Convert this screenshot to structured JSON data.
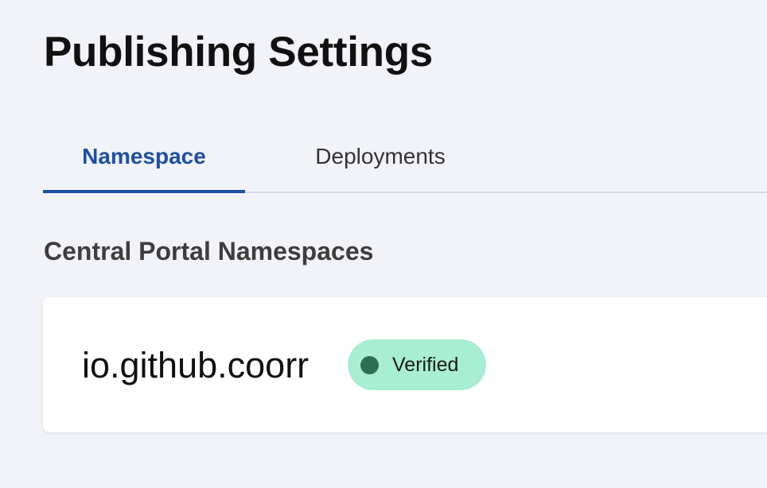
{
  "page": {
    "title": "Publishing Settings"
  },
  "tabs": [
    {
      "label": "Namespace",
      "active": true
    },
    {
      "label": "Deployments",
      "active": false
    }
  ],
  "section": {
    "heading": "Central Portal Namespaces"
  },
  "namespaces": [
    {
      "name": "io.github.coorr",
      "status": "Verified"
    }
  ],
  "colors": {
    "background": "#f2f3f8",
    "accent": "#1d4fa5",
    "tab_baseline": "#d3d9e6",
    "card": "#ffffff",
    "verified_badge_bg": "#a8eed2",
    "verified_dot": "#2b7050"
  }
}
